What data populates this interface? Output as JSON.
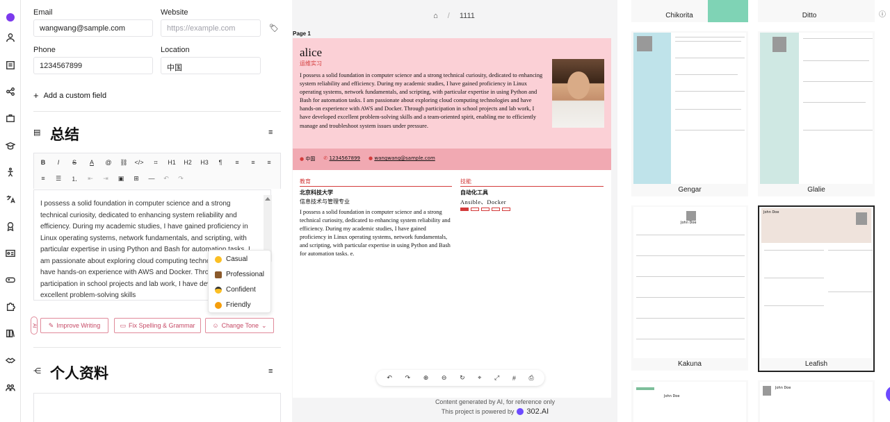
{
  "rail": {
    "items": [
      "logo-icon",
      "user-icon",
      "document-icon",
      "share-icon",
      "briefcase-icon",
      "graduation-icon",
      "person-icon",
      "translate-icon",
      "award-icon",
      "id-card-icon",
      "gamepad-icon",
      "puzzle-icon",
      "book-icon",
      "handshake-icon",
      "people-icon"
    ]
  },
  "contact": {
    "email_label": "Email",
    "email_value": "wangwang@sample.com",
    "website_label": "Website",
    "website_placeholder": "https://example.com",
    "phone_label": "Phone",
    "phone_value": "1234567899",
    "location_label": "Location",
    "location_value": "中国",
    "add_field": "Add a custom field"
  },
  "summary": {
    "title": "总结",
    "text": "I possess a solid foundation in computer science and a strong technical curiosity, dedicated to enhancing system reliability and efficiency. During my academic studies, I have gained proficiency in Linux operating systems, network fundamentals, and scripting, with particular expertise in using Python and Bash for automation tasks. I am passionate about exploring cloud computing technologies and have hands-on experience with AWS and Docker. Through participation in school projects and lab work, I have developed excellent problem-solving skills"
  },
  "tone_menu": {
    "items": [
      "Casual",
      "Professional",
      "Confident",
      "Friendly"
    ]
  },
  "ai_buttons": {
    "ai": "AI",
    "improve": "Improve Writing",
    "fix": "Fix Spelling & Grammar",
    "tone": "Change Tone"
  },
  "profiles": {
    "title": "个人资料"
  },
  "breadcrumb": {
    "id": "1111"
  },
  "preview": {
    "page_label": "Page 1",
    "name": "alice",
    "headline": "运维实习",
    "summary": "I possess a solid foundation in computer science and a strong technical curiosity, dedicated to enhancing system reliability and efficiency. During my academic studies, I have gained proficiency in Linux operating systems, network fundamentals, and scripting, with particular expertise in using Python and Bash for automation tasks. I am passionate about exploring cloud computing technologies and have hands-on experience with AWS and Docker. Through participation in school projects and lab work, I have developed excellent problem-solving skills and a team-oriented spirit, enabling me to efficiently manage and troubleshoot system issues under pressure.",
    "location": "中国",
    "phone": "1234567899",
    "email": "wangwang@sample.com",
    "edu_heading": "教育",
    "school": "北京科技大学",
    "major": "信息技术与管理专业",
    "edu_text": "I possess a solid foundation in computer science and a strong technical curiosity, dedicated to enhancing system reliability and efficiency. During my academic studies, I have gained proficiency in Linux operating systems, network fundamentals, and scripting, with particular expertise in using Python and Bash for automation tasks. e.",
    "skills_heading": "技能",
    "skill_name": "自动化工具",
    "skill_keywords": "Ansible、Docker",
    "skill_level": 1,
    "skill_level_max": 5
  },
  "footer": {
    "line1": "Content generated by AI, for reference only",
    "line2": "This project is powered by",
    "brand": "302.AI"
  },
  "templates": {
    "names": [
      "Chikorita",
      "Ditto",
      "Gengar",
      "Glalie",
      "Kakuna",
      "Leafish"
    ],
    "sample_name": "John Doe"
  },
  "colors": {
    "accent": "#c64a66",
    "pink": "#fbd0d6",
    "pink_dark": "#f1a9b2",
    "red": "#d33b3b"
  }
}
